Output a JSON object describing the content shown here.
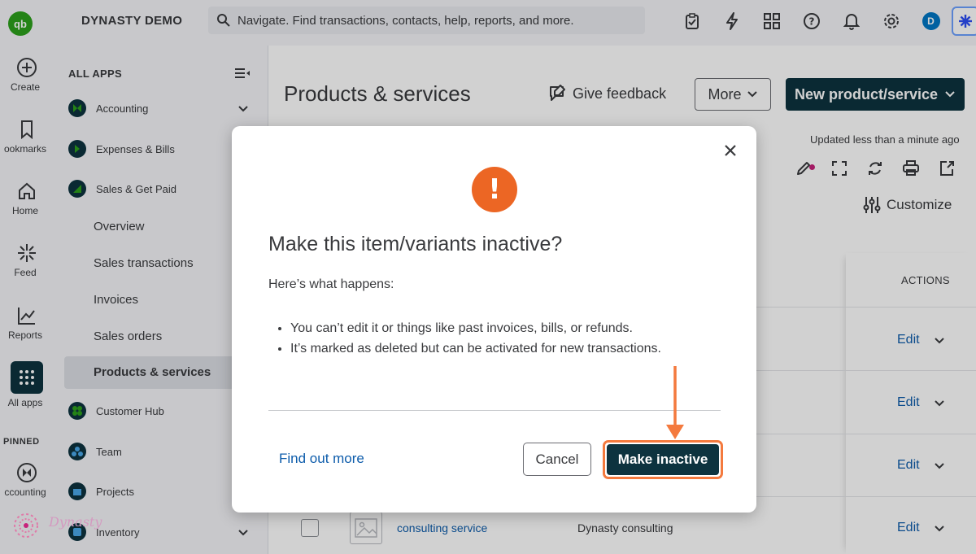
{
  "rail": {
    "create": "Create",
    "bookmarks": "ookmarks",
    "home": "Home",
    "feed": "Feed",
    "reports": "Reports",
    "all_apps": "All apps",
    "pinned": "PINNED",
    "pinned_accounting": "ccounting"
  },
  "topbar": {
    "company": "DYNASTY DEMO",
    "search_placeholder": "Navigate. Find transactions, contacts, help, reports, and more.",
    "avatar_initial": "D"
  },
  "panel": {
    "heading": "ALL APPS",
    "apps": [
      {
        "label": "Accounting"
      },
      {
        "label": "Expenses & Bills"
      },
      {
        "label": "Sales & Get Paid"
      }
    ],
    "sub_items": [
      "Overview",
      "Sales transactions",
      "Invoices",
      "Sales orders",
      "Products & services"
    ],
    "apps_lower": [
      {
        "label": "Customer Hub"
      },
      {
        "label": "Team"
      },
      {
        "label": "Projects"
      },
      {
        "label": "Inventory"
      }
    ]
  },
  "main": {
    "title": "Products & services",
    "feedback": "Give feedback",
    "more": "More",
    "new_button": "New product/service",
    "updated": "Updated less than a minute ago",
    "customize": "Customize",
    "actions_header": "ACTIONS",
    "edit_label": "Edit",
    "row": {
      "name": "consulting service",
      "description": "Dynasty consulting"
    }
  },
  "modal": {
    "title": "Make this item/variants inactive?",
    "subtitle": "Here’s what happens:",
    "bullets": [
      "You can’t edit it or things like past invoices, bills, or refunds.",
      "It’s marked as deleted but can be activated for new transactions."
    ],
    "find_more": "Find out more",
    "cancel": "Cancel",
    "confirm": "Make inactive",
    "warning_glyph": "!"
  },
  "watermark": {
    "text": "Dynasty"
  },
  "colors": {
    "brand_dark": "#0d333f",
    "qb_green": "#2ca01c",
    "warning_orange": "#ec6624",
    "link_blue": "#0d5cab",
    "highlight_arrow": "#f47a3e"
  }
}
